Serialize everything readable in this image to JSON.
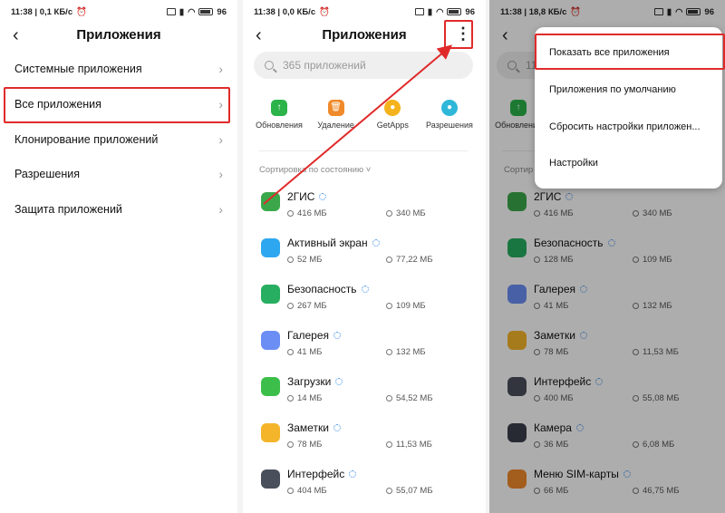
{
  "colors": {
    "accent_red": "#e02a2a",
    "link_blue": "#3d8fe6"
  },
  "screens": [
    {
      "status": {
        "time_speed": "11:38 | 0,1 КБ/с",
        "battery": "96"
      },
      "title": "Приложения",
      "menu": [
        {
          "label": "Системные приложения",
          "icon": "chevron-right-icon"
        },
        {
          "label": "Все приложения",
          "icon": "chevron-right-icon"
        },
        {
          "label": "Клонирование приложений",
          "icon": "chevron-right-icon"
        },
        {
          "label": "Разрешения",
          "icon": "chevron-right-icon"
        },
        {
          "label": "Защита приложений",
          "icon": "chevron-right-icon"
        }
      ]
    },
    {
      "status": {
        "time_speed": "11:38 | 0,0 КБ/с",
        "battery": "96"
      },
      "title": "Приложения",
      "search_placeholder": "365 приложений",
      "actions": [
        {
          "label": "Обновления",
          "color": "#2cb34a",
          "icon": "update-icon"
        },
        {
          "label": "Удаление",
          "color": "#f08a2a",
          "icon": "trash-icon"
        },
        {
          "label": "GetApps",
          "color": "#f4b21c",
          "icon": "getapps-icon"
        },
        {
          "label": "Разрешения",
          "color": "#2fb7d9",
          "icon": "permissions-icon"
        }
      ],
      "sort_label": "Сортировка по состоянию",
      "apps": [
        {
          "name": "2ГИС",
          "size": "416 МБ",
          "cache": "340 МБ",
          "color": "#3aa84a"
        },
        {
          "name": "Активный экран",
          "size": "52 МБ",
          "cache": "77,22 МБ",
          "color": "#2da8f0"
        },
        {
          "name": "Безопасность",
          "size": "267 МБ",
          "cache": "109 МБ",
          "color": "#27ae60"
        },
        {
          "name": "Галерея",
          "size": "41 МБ",
          "cache": "132 МБ",
          "color": "#6b8ef5"
        },
        {
          "name": "Загрузки",
          "size": "14 МБ",
          "cache": "54,52 МБ",
          "color": "#3cbf4a"
        },
        {
          "name": "Заметки",
          "size": "78 МБ",
          "cache": "11,53 МБ",
          "color": "#f5b52a"
        },
        {
          "name": "Интерфейс",
          "size": "404 МБ",
          "cache": "55,07 МБ",
          "color": "#4a4f5c"
        }
      ]
    },
    {
      "status": {
        "time_speed": "11:38 | 18,8 КБ/с",
        "battery": "96"
      },
      "search_partial": "11",
      "actions_partial": [
        "Обновления"
      ],
      "sort_partial": "Сортир",
      "apps": [
        {
          "name": "2ГИС",
          "size": "416 МБ",
          "cache": "340 МБ",
          "color": "#3aa84a"
        },
        {
          "name": "Безопасность",
          "size": "128 МБ",
          "cache": "109 МБ",
          "color": "#27ae60"
        },
        {
          "name": "Галерея",
          "size": "41 МБ",
          "cache": "132 МБ",
          "color": "#6b8ef5"
        },
        {
          "name": "Заметки",
          "size": "78 МБ",
          "cache": "11,53 МБ",
          "color": "#f5b52a"
        },
        {
          "name": "Интерфейс",
          "size": "400 МБ",
          "cache": "55,08 МБ",
          "color": "#4a4f5c"
        },
        {
          "name": "Камера",
          "size": "36 МБ",
          "cache": "6,08 МБ",
          "color": "#3a3f4a"
        },
        {
          "name": "Меню SIM-карты",
          "size": "66 МБ",
          "cache": "46,75 МБ",
          "color": "#f08a2a"
        }
      ],
      "popup": [
        {
          "label": "Показать все приложения"
        },
        {
          "label": "Приложения по умолчанию"
        },
        {
          "label": "Сбросить настройки приложен..."
        },
        {
          "label": "Настройки"
        }
      ]
    }
  ]
}
